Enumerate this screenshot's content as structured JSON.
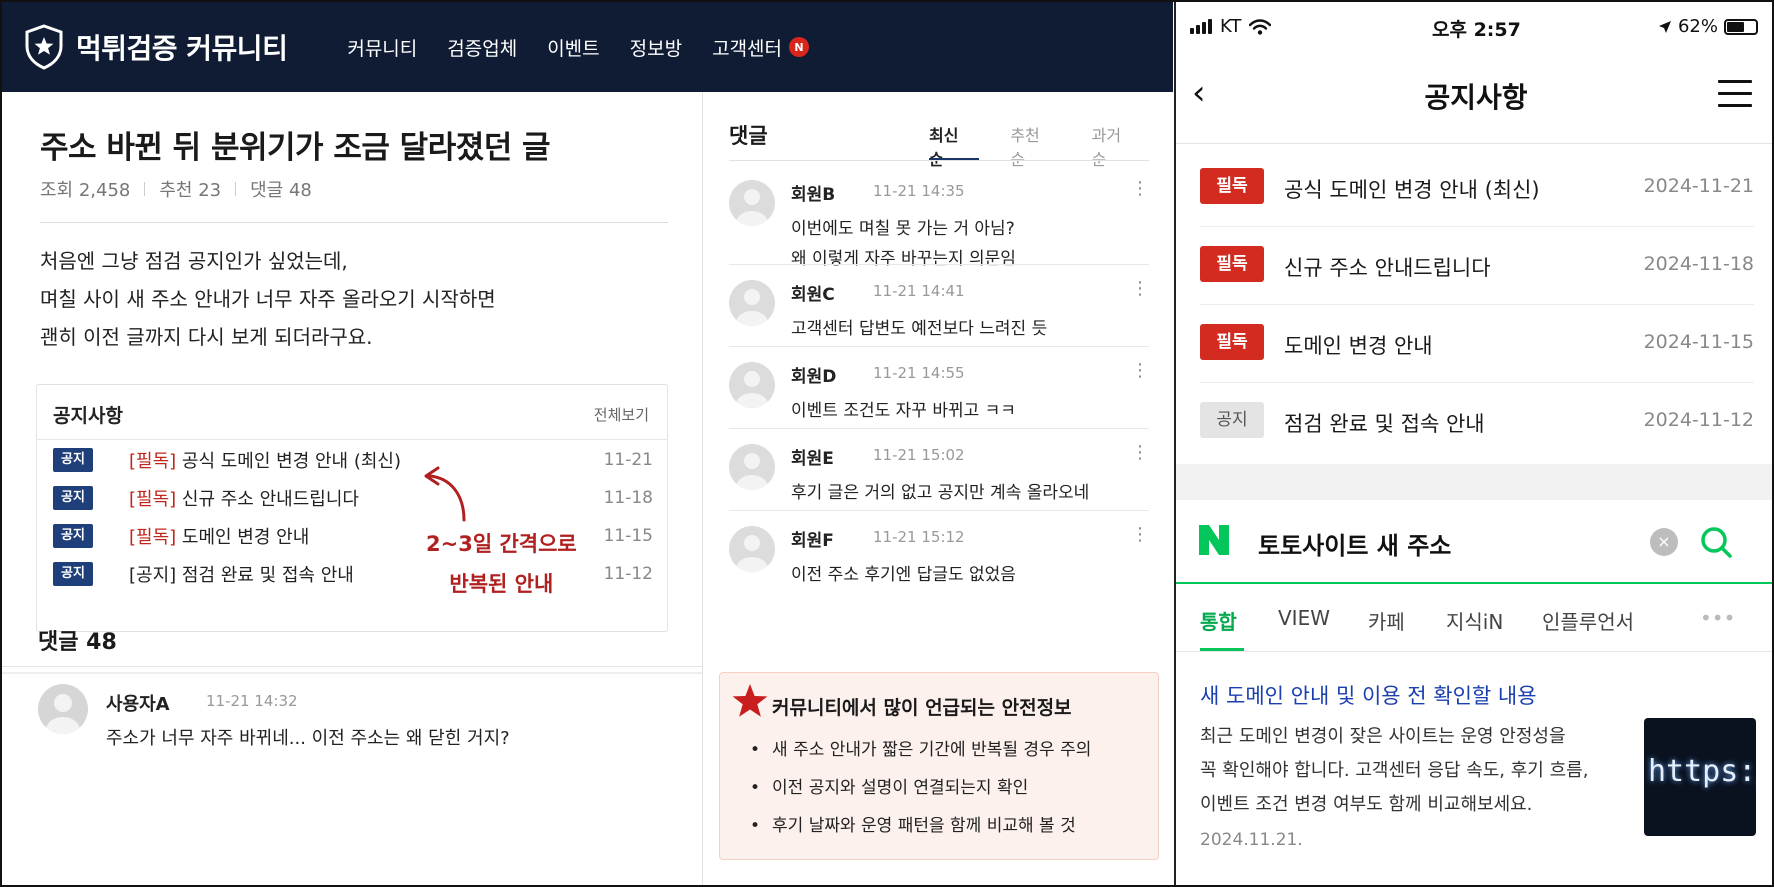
{
  "community": {
    "site_name": "먹튀검증 커뮤니티",
    "nav": [
      "커뮤니티",
      "검증업체",
      "이벤트",
      "정보방",
      "고객센터"
    ],
    "nav_badge": "N",
    "post": {
      "title": "주소 바뀐 뒤 분위기가 조금 달라졌던 글",
      "views": "조회 2,458",
      "likes": "추천 23",
      "comments_count": "댓글 48",
      "body": [
        "처음엔 그냥 점검 공지인가 싶었는데,",
        "며칠 사이 새 주소 안내가 너무 자주 올라오기 시작하면",
        "괜히 이전 글까지 다시 보게 되더라구요."
      ]
    },
    "notice_box": {
      "title": "공지사항",
      "view_all": "전체보기",
      "items": [
        {
          "tag": "공지",
          "prefix": "[필독]",
          "text": "공식 도메인 변경 안내 (최신)",
          "date": "11-21"
        },
        {
          "tag": "공지",
          "prefix": "[필독]",
          "text": "신규 주소 안내드립니다",
          "date": "11-18"
        },
        {
          "tag": "공지",
          "prefix": "[필독]",
          "text": "도메인 변경 안내",
          "date": "11-15"
        },
        {
          "tag": "공지",
          "prefix": "",
          "text": "[공지] 점검 완료 및 접속 안내",
          "date": "11-12"
        }
      ],
      "annotation_line1": "2~3일 간격으로",
      "annotation_line2": "반복된 안내"
    },
    "bottom_comments": {
      "title": "댓글 48",
      "first": {
        "name": "사용자A",
        "time": "11-21 14:32",
        "text": "주소가 너무 자주 바뀌네... 이전 주소는 왜 닫힌 거지?"
      }
    },
    "comments_panel": {
      "title": "댓글",
      "sort_tabs": [
        "최신순",
        "추천순",
        "과거순"
      ],
      "comments": [
        {
          "name": "회원B",
          "time": "11-21 14:35",
          "lines": [
            "이번에도 며칠 못 가는 거 아님?",
            "왜 이렇게 자주 바꾸는지 의문임"
          ]
        },
        {
          "name": "회원C",
          "time": "11-21 14:41",
          "lines": [
            "고객센터 답변도 예전보다 느려진 듯"
          ]
        },
        {
          "name": "회원D",
          "time": "11-21 14:55",
          "lines": [
            "이벤트 조건도 자꾸 바뀌고 ㅋㅋ"
          ]
        },
        {
          "name": "회원E",
          "time": "11-21 15:02",
          "lines": [
            "후기 글은 거의 없고 공지만 계속 올라오네"
          ]
        },
        {
          "name": "회원F",
          "time": "11-21 15:12",
          "lines": [
            "이전 주소 후기엔 답글도 없었음"
          ]
        }
      ],
      "safety": {
        "title": "커뮤니티에서 많이 언급되는 안전정보",
        "items": [
          "새 주소 안내가 짧은 기간에 반복될 경우 주의",
          "이전 공지와 설명이 연결되는지 확인",
          "후기 날짜와 운영 패턴을 함께 비교해 볼 것"
        ]
      }
    }
  },
  "phone": {
    "status": {
      "carrier": "KT",
      "time": "오후 2:57",
      "battery": "62%",
      "battery_level": 0.62
    },
    "header_title": "공지사항",
    "notices": [
      {
        "badge": "필독",
        "badge_style": "red",
        "text": "공식 도메인 변경 안내 (최신)",
        "date": "2024-11-21"
      },
      {
        "badge": "필독",
        "badge_style": "red",
        "text": "신규 주소 안내드립니다",
        "date": "2024-11-18"
      },
      {
        "badge": "필독",
        "badge_style": "red",
        "text": "도메인 변경 안내",
        "date": "2024-11-15"
      },
      {
        "badge": "공지",
        "badge_style": "gray",
        "text": "점검 완료 및 접속 안내",
        "date": "2024-11-12"
      }
    ],
    "search": {
      "logo": "N",
      "query": "토토사이트 새 주소",
      "clear": "×",
      "tabs": [
        "통합",
        "VIEW",
        "카페",
        "지식iN",
        "인플루언서"
      ],
      "more": "•••",
      "result": {
        "title": "새 도메인 안내 및 이용 전 확인할 내용",
        "desc": [
          "최근 도메인 변경이 잦은 사이트는 운영 안정성을",
          "꼭 확인해야 합니다. 고객센터 응답 속도, 후기 흐름,",
          "이벤트 조건 변경 여부도 함께 비교해보세요."
        ],
        "date": "2024.11.21.",
        "thumb_text": "https://"
      }
    }
  },
  "colors": {
    "nav_bg": "#0f1c34",
    "notice_tag": "#1e3f7a",
    "red": "#d42b21",
    "naver_green": "#03c75a",
    "link_blue": "#1a3fb0"
  }
}
